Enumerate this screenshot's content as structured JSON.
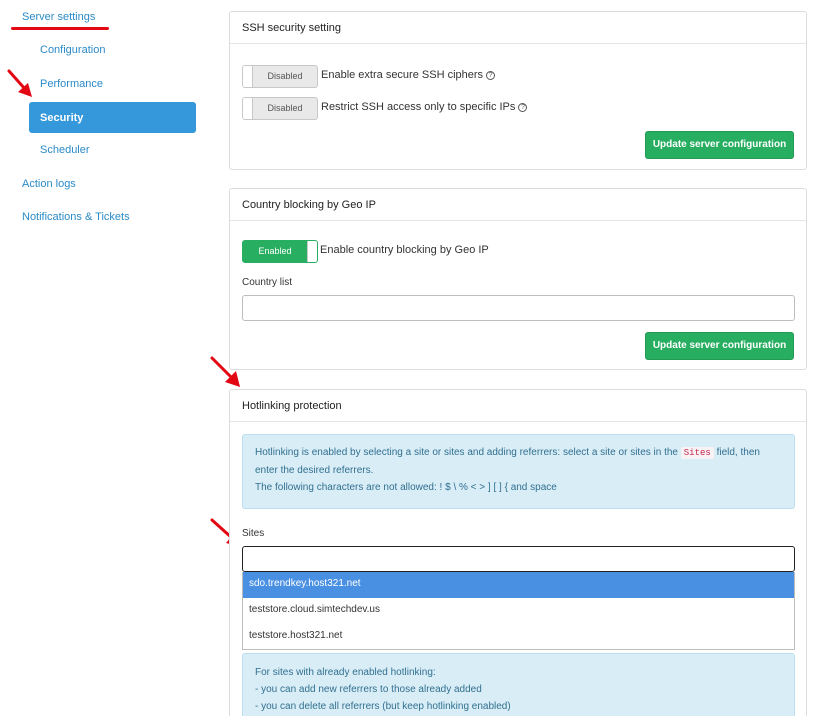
{
  "sidebar": {
    "server_settings": "Server settings",
    "configuration": "Configuration",
    "performance": "Performance",
    "security": "Security",
    "scheduler": "Scheduler",
    "action_logs": "Action logs",
    "notifications": "Notifications & Tickets"
  },
  "ssh": {
    "title": "SSH security setting",
    "ciphers_toggle": "Disabled",
    "ciphers_label": "Enable extra secure SSH ciphers",
    "ips_toggle": "Disabled",
    "ips_label": "Restrict SSH access only to specific IPs",
    "update_button": "Update server configuration"
  },
  "geo": {
    "title": "Country blocking by Geo IP",
    "toggle": "Enabled",
    "toggle_label": "Enable country blocking by Geo IP",
    "country_list_label": "Country list",
    "country_list_value": "",
    "update_button": "Update server configuration"
  },
  "hotlink": {
    "title": "Hotlinking protection",
    "info_part1": "Hotlinking is enabled by selecting a site or sites and adding referrers: select a site or sites in the",
    "info_code": "Sites",
    "info_part2": "field, then",
    "info_line2": "enter the desired referrers.",
    "info_line3": "The following characters are not allowed: ! $ \\ % < > ] [ ] { and space",
    "sites_label": "Sites",
    "sites_value": "",
    "options": [
      "sdo.trendkey.host321.net",
      "teststore.cloud.simtechdev.us",
      "teststore.host321.net"
    ],
    "note_line1": "For sites with already enabled hotlinking:",
    "note_line2": "- you can add new referrers to those already added",
    "note_line3": "- you can delete all referrers (but keep hotlinking enabled)"
  },
  "colors": {
    "link": "#2a8ac7",
    "active": "#3498db",
    "green": "#27ae60",
    "annotation": "#e30613"
  }
}
